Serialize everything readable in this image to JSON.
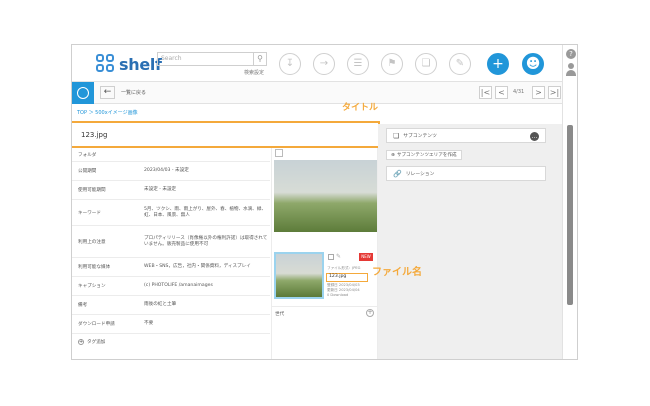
{
  "header": {
    "logo_text": "shelf",
    "search_placeholder": "Search",
    "search_settings": "検索設定",
    "icons": [
      "download-icon",
      "share-icon",
      "document-icon",
      "flag-icon",
      "copy-icon",
      "edit-icon",
      "add-icon",
      "user-settings-icon"
    ]
  },
  "toolbar": {
    "back_label": "一覧に戻る",
    "page": "4/31"
  },
  "breadcrumb": "TOP ＞ 500xイメージ画像",
  "title": "123.jpg",
  "meta_rows": [
    {
      "key": "フォルダ",
      "value": ""
    },
    {
      "key": "公開期間",
      "value": "2023/04/03 - 未設定"
    },
    {
      "key": "使用可能期間",
      "value": "未設定 - 未設定"
    },
    {
      "key": "キーワード",
      "value": "5月、ツクシ、雨、雨上がり、屋外、春、植物、水滴、緑、虹、日本、風景、無人"
    },
    {
      "key": "利用上の注意",
      "value": "プロパティリリース（肖像権以外の権利許諾）は取得されていません。販売製品に使用不可"
    },
    {
      "key": "利用可能な媒体",
      "value": "WEB・SNS，広告，社内・関係資料，ディスプレイ"
    },
    {
      "key": "キャプション",
      "value": "(c) PHOTOLIFE /amanaimages"
    },
    {
      "key": "備考",
      "value": "雨後の虹と土筆"
    },
    {
      "key": "ダウンロード申請",
      "value": "不要"
    }
  ],
  "tag_add": "タグ追加",
  "file_card": {
    "badge": "NEW",
    "info_top": "ファイル形式：JPEG",
    "file_name": "123.jpg",
    "info_lines": [
      "登録日 2023/04/03",
      "更新日 2023/04/04",
      "0 Download"
    ]
  },
  "history_label": "世代",
  "right_panel": {
    "sub_content": "サブコンテンツ",
    "create_sub_area": "サブコンテンツエリアを作成",
    "relation": "リレーション"
  },
  "annotations": {
    "title_label": "タイトル",
    "filename_label": "ファイル名"
  },
  "colors": {
    "accent": "#2196d9",
    "highlight": "#f4a93b",
    "new_badge": "#e53935"
  }
}
